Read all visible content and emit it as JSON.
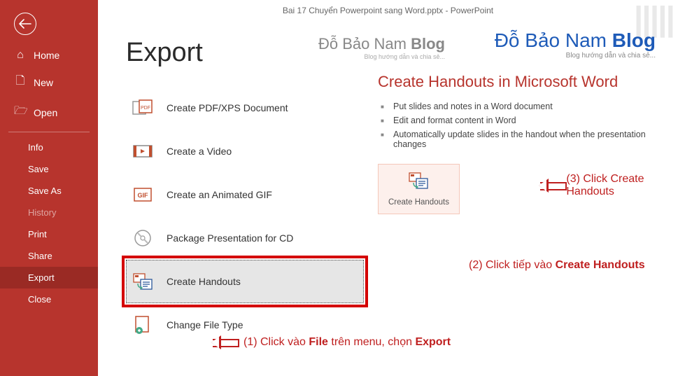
{
  "titlebar": "Bai 17 Chuyển Powerpoint sang Word.pptx  -  PowerPoint",
  "sidebar": {
    "home": "Home",
    "new": "New",
    "open": "Open",
    "info": "Info",
    "save": "Save",
    "saveas": "Save As",
    "history": "History",
    "print": "Print",
    "share": "Share",
    "export": "Export",
    "close": "Close"
  },
  "page_title": "Export",
  "export_options": {
    "pdf": "Create PDF/XPS Document",
    "video": "Create a Video",
    "gif": "Create an Animated GIF",
    "cd": "Package Presentation for CD",
    "handouts": "Create Handouts",
    "filetype": "Change File Type"
  },
  "right": {
    "title": "Create Handouts in Microsoft Word",
    "bullets": [
      "Put slides and notes in a Word document",
      "Edit and format content in Word",
      "Automatically update slides in the handout when the presentation changes"
    ],
    "button_label": "Create Handouts"
  },
  "logo": {
    "line1a": "Đỗ ",
    "line1b": "Bảo Nam ",
    "line1c": "Blog",
    "line2": "Blog hướng dẫn và chia sẻ..."
  },
  "annotations": {
    "a1_prefix": "(1) Click vào ",
    "a1_b1": "File",
    "a1_mid": " trên menu, chọn ",
    "a1_b2": "Export",
    "a2_prefix": "(2) Click tiếp vào ",
    "a2_b": "Create Handouts",
    "a3": "(3) Click Create Handouts"
  }
}
